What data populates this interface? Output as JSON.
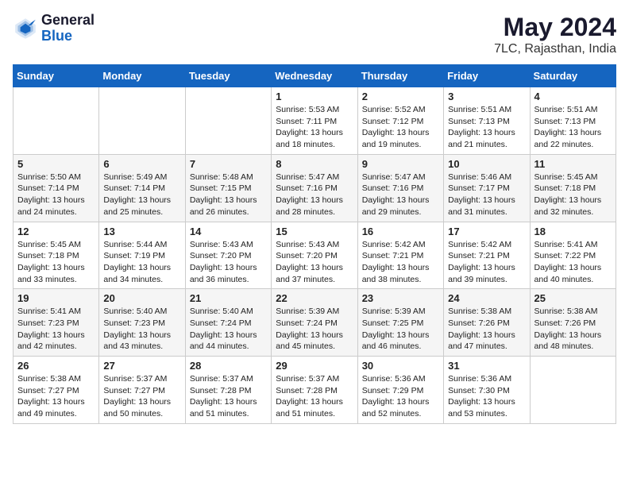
{
  "logo": {
    "general": "General",
    "blue": "Blue"
  },
  "title": "May 2024",
  "location": "7LC, Rajasthan, India",
  "days_of_week": [
    "Sunday",
    "Monday",
    "Tuesday",
    "Wednesday",
    "Thursday",
    "Friday",
    "Saturday"
  ],
  "weeks": [
    [
      {
        "day": "",
        "info": ""
      },
      {
        "day": "",
        "info": ""
      },
      {
        "day": "",
        "info": ""
      },
      {
        "day": "1",
        "info": "Sunrise: 5:53 AM\nSunset: 7:11 PM\nDaylight: 13 hours and 18 minutes."
      },
      {
        "day": "2",
        "info": "Sunrise: 5:52 AM\nSunset: 7:12 PM\nDaylight: 13 hours and 19 minutes."
      },
      {
        "day": "3",
        "info": "Sunrise: 5:51 AM\nSunset: 7:13 PM\nDaylight: 13 hours and 21 minutes."
      },
      {
        "day": "4",
        "info": "Sunrise: 5:51 AM\nSunset: 7:13 PM\nDaylight: 13 hours and 22 minutes."
      }
    ],
    [
      {
        "day": "5",
        "info": "Sunrise: 5:50 AM\nSunset: 7:14 PM\nDaylight: 13 hours and 24 minutes."
      },
      {
        "day": "6",
        "info": "Sunrise: 5:49 AM\nSunset: 7:14 PM\nDaylight: 13 hours and 25 minutes."
      },
      {
        "day": "7",
        "info": "Sunrise: 5:48 AM\nSunset: 7:15 PM\nDaylight: 13 hours and 26 minutes."
      },
      {
        "day": "8",
        "info": "Sunrise: 5:47 AM\nSunset: 7:16 PM\nDaylight: 13 hours and 28 minutes."
      },
      {
        "day": "9",
        "info": "Sunrise: 5:47 AM\nSunset: 7:16 PM\nDaylight: 13 hours and 29 minutes."
      },
      {
        "day": "10",
        "info": "Sunrise: 5:46 AM\nSunset: 7:17 PM\nDaylight: 13 hours and 31 minutes."
      },
      {
        "day": "11",
        "info": "Sunrise: 5:45 AM\nSunset: 7:18 PM\nDaylight: 13 hours and 32 minutes."
      }
    ],
    [
      {
        "day": "12",
        "info": "Sunrise: 5:45 AM\nSunset: 7:18 PM\nDaylight: 13 hours and 33 minutes."
      },
      {
        "day": "13",
        "info": "Sunrise: 5:44 AM\nSunset: 7:19 PM\nDaylight: 13 hours and 34 minutes."
      },
      {
        "day": "14",
        "info": "Sunrise: 5:43 AM\nSunset: 7:20 PM\nDaylight: 13 hours and 36 minutes."
      },
      {
        "day": "15",
        "info": "Sunrise: 5:43 AM\nSunset: 7:20 PM\nDaylight: 13 hours and 37 minutes."
      },
      {
        "day": "16",
        "info": "Sunrise: 5:42 AM\nSunset: 7:21 PM\nDaylight: 13 hours and 38 minutes."
      },
      {
        "day": "17",
        "info": "Sunrise: 5:42 AM\nSunset: 7:21 PM\nDaylight: 13 hours and 39 minutes."
      },
      {
        "day": "18",
        "info": "Sunrise: 5:41 AM\nSunset: 7:22 PM\nDaylight: 13 hours and 40 minutes."
      }
    ],
    [
      {
        "day": "19",
        "info": "Sunrise: 5:41 AM\nSunset: 7:23 PM\nDaylight: 13 hours and 42 minutes."
      },
      {
        "day": "20",
        "info": "Sunrise: 5:40 AM\nSunset: 7:23 PM\nDaylight: 13 hours and 43 minutes."
      },
      {
        "day": "21",
        "info": "Sunrise: 5:40 AM\nSunset: 7:24 PM\nDaylight: 13 hours and 44 minutes."
      },
      {
        "day": "22",
        "info": "Sunrise: 5:39 AM\nSunset: 7:24 PM\nDaylight: 13 hours and 45 minutes."
      },
      {
        "day": "23",
        "info": "Sunrise: 5:39 AM\nSunset: 7:25 PM\nDaylight: 13 hours and 46 minutes."
      },
      {
        "day": "24",
        "info": "Sunrise: 5:38 AM\nSunset: 7:26 PM\nDaylight: 13 hours and 47 minutes."
      },
      {
        "day": "25",
        "info": "Sunrise: 5:38 AM\nSunset: 7:26 PM\nDaylight: 13 hours and 48 minutes."
      }
    ],
    [
      {
        "day": "26",
        "info": "Sunrise: 5:38 AM\nSunset: 7:27 PM\nDaylight: 13 hours and 49 minutes."
      },
      {
        "day": "27",
        "info": "Sunrise: 5:37 AM\nSunset: 7:27 PM\nDaylight: 13 hours and 50 minutes."
      },
      {
        "day": "28",
        "info": "Sunrise: 5:37 AM\nSunset: 7:28 PM\nDaylight: 13 hours and 51 minutes."
      },
      {
        "day": "29",
        "info": "Sunrise: 5:37 AM\nSunset: 7:28 PM\nDaylight: 13 hours and 51 minutes."
      },
      {
        "day": "30",
        "info": "Sunrise: 5:36 AM\nSunset: 7:29 PM\nDaylight: 13 hours and 52 minutes."
      },
      {
        "day": "31",
        "info": "Sunrise: 5:36 AM\nSunset: 7:30 PM\nDaylight: 13 hours and 53 minutes."
      },
      {
        "day": "",
        "info": ""
      }
    ]
  ]
}
